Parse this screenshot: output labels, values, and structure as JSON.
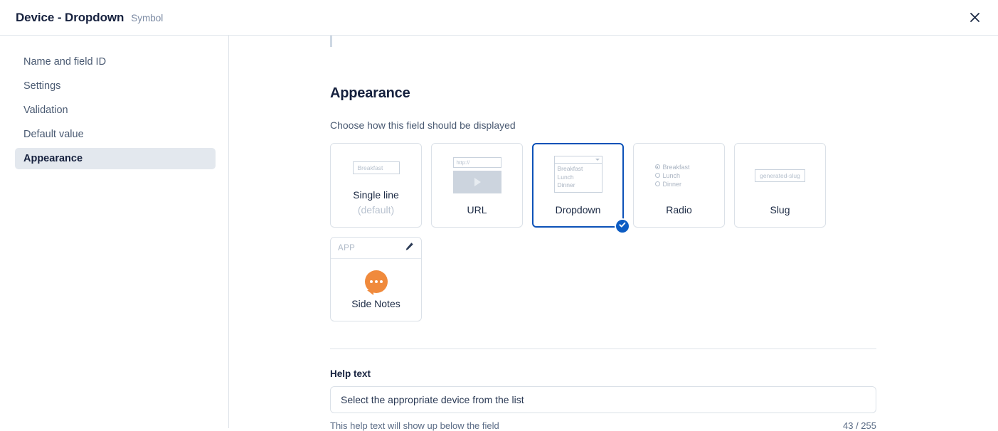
{
  "header": {
    "title": "Device - Dropdown",
    "subtitle": "Symbol",
    "close_icon": "close-icon"
  },
  "sidebar": {
    "items": [
      {
        "label": "Name and field ID",
        "active": false
      },
      {
        "label": "Settings",
        "active": false
      },
      {
        "label": "Validation",
        "active": false
      },
      {
        "label": "Default value",
        "active": false
      },
      {
        "label": "Appearance",
        "active": true
      }
    ]
  },
  "main": {
    "section_title": "Appearance",
    "section_subtitle": "Choose how this field should be displayed",
    "options": [
      {
        "label": "Single line",
        "sublabel": "(default)",
        "placeholder": "Breakfast",
        "selected": false
      },
      {
        "label": "URL",
        "url_placeholder": "http://",
        "selected": false
      },
      {
        "label": "Dropdown",
        "options_preview": [
          "Breakfast",
          "Lunch",
          "Dinner"
        ],
        "selected": true
      },
      {
        "label": "Radio",
        "radio_options": [
          "Breakfast",
          "Lunch",
          "Dinner"
        ],
        "radio_selected_index": 0,
        "selected": false
      },
      {
        "label": "Slug",
        "placeholder": "generated-slug",
        "selected": false
      }
    ],
    "app_option": {
      "header_label": "APP",
      "edit_icon": "pencil-icon",
      "icon": "speech-bubble-icon",
      "label": "Side Notes",
      "icon_color": "#f08a3c"
    },
    "help": {
      "label": "Help text",
      "value": "Select the appropriate device from the list",
      "placeholder": "Help text",
      "hint": "This help text will show up below the field",
      "counter": "43 / 255"
    }
  },
  "colors": {
    "accent": "#0d52b8",
    "check_badge": "#0d5cc3",
    "border": "#dbe1e8",
    "text_dark": "#16213e",
    "text_muted": "#7b8aa3"
  }
}
